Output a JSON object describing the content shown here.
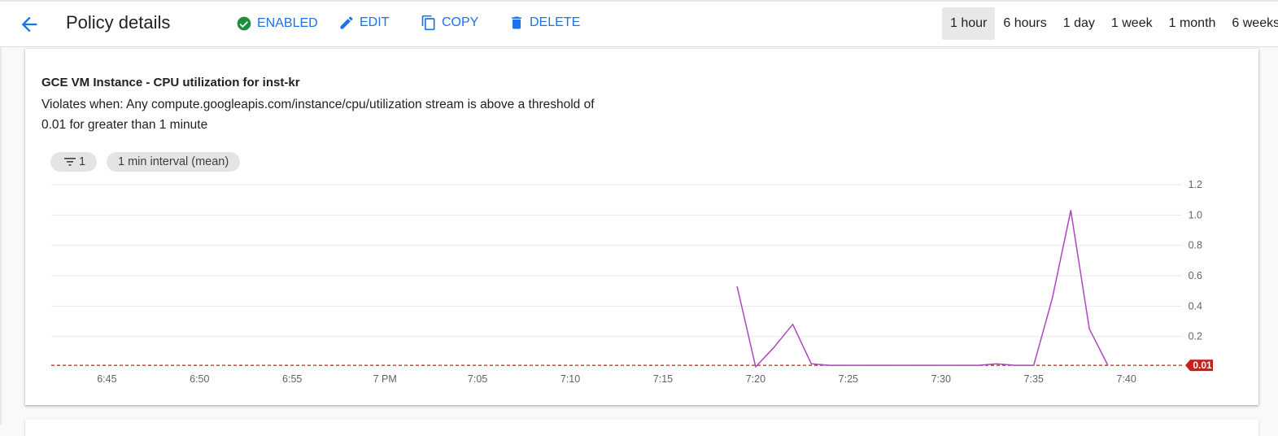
{
  "header": {
    "title": "Policy details",
    "status_label": "ENABLED",
    "edit_label": "EDIT",
    "copy_label": "COPY",
    "delete_label": "DELETE",
    "ranges": [
      "1 hour",
      "6 hours",
      "1 day",
      "1 week",
      "1 month",
      "6 weeks"
    ],
    "active_range": "1 hour"
  },
  "card": {
    "title": "GCE VM Instance - CPU utilization for inst-kr",
    "description": "Violates when: Any compute.googleapis.com/instance/cpu/utilization stream is above a threshold of 0.01 for greater than 1 minute",
    "filter_chip": "1",
    "interval_chip": "1 min interval (mean)"
  },
  "colors": {
    "accent": "#1a73e8",
    "enabled": "#1e8e3e",
    "series": "#ab47bc",
    "threshold": "#c5221f"
  },
  "chart_data": {
    "type": "line",
    "x_ticks": [
      "6:45",
      "6:50",
      "6:55",
      "7 PM",
      "7:05",
      "7:10",
      "7:15",
      "7:20",
      "7:25",
      "7:30",
      "7:35",
      "7:40"
    ],
    "x_tick_minutes": [
      45,
      50,
      55,
      60,
      65,
      70,
      75,
      80,
      85,
      90,
      95,
      100
    ],
    "x_range_minutes": [
      42,
      103
    ],
    "y_ticks": [
      "0.2",
      "0.4",
      "0.6",
      "0.8",
      "1.0",
      "1.2"
    ],
    "ylim": [
      0,
      1.2
    ],
    "series": [
      {
        "x_minutes": [
          79,
          80,
          81,
          82,
          83,
          84,
          85,
          86,
          87,
          88,
          89,
          90,
          91,
          92,
          93,
          94,
          95,
          96,
          97,
          98,
          99
        ],
        "values": [
          0.53,
          0.0,
          0.13,
          0.28,
          0.02,
          0.01,
          0.01,
          0.01,
          0.01,
          0.01,
          0.01,
          0.01,
          0.01,
          0.01,
          0.02,
          0.01,
          0.01,
          0.45,
          1.03,
          0.25,
          0.01
        ]
      }
    ],
    "threshold": 0.01,
    "threshold_label": "0.01",
    "grid": true
  }
}
